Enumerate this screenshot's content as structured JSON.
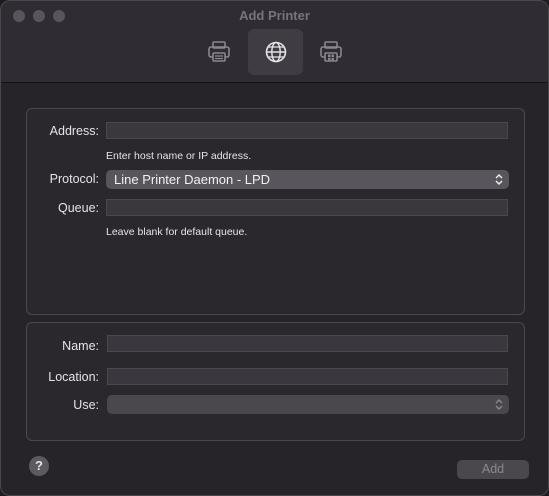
{
  "window": {
    "title": "Add Printer"
  },
  "toolbar": {
    "tabs": [
      {
        "icon": "printer-icon",
        "selected": false
      },
      {
        "icon": "globe-icon",
        "selected": true
      },
      {
        "icon": "printer-windows-icon",
        "selected": false
      }
    ]
  },
  "ip_panel": {
    "address_label": "Address:",
    "address_value": "",
    "address_hint": "Enter host name or IP address.",
    "protocol_label": "Protocol:",
    "protocol_value": "Line Printer Daemon - LPD",
    "queue_label": "Queue:",
    "queue_value": "",
    "queue_hint": "Leave blank for default queue."
  },
  "details_panel": {
    "name_label": "Name:",
    "name_value": "",
    "location_label": "Location:",
    "location_value": "",
    "use_label": "Use:",
    "use_value": ""
  },
  "footer": {
    "help_label": "?",
    "add_label": "Add"
  }
}
